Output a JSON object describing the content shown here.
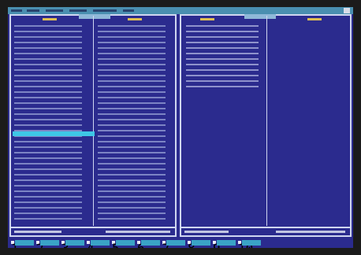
{
  "app": {
    "title": "",
    "accent_color": "#3ec6e6",
    "panel_background": "#2b2b8e",
    "menu_background": "#4a8fb0"
  },
  "menubar": {
    "items": [
      "",
      "",
      "",
      "",
      "",
      ""
    ],
    "close_icon": "close-icon"
  },
  "left_panel": {
    "path": "",
    "columns": [
      "",
      ""
    ],
    "selected_row": 21,
    "status": ""
  },
  "right_panel": {
    "path": "",
    "columns": [
      "",
      ""
    ],
    "status": ""
  },
  "keybar": {
    "keys": [
      {
        "num": "1",
        "label": ""
      },
      {
        "num": "2",
        "label": ""
      },
      {
        "num": "3",
        "label": ""
      },
      {
        "num": "4",
        "label": ""
      },
      {
        "num": "5",
        "label": ""
      },
      {
        "num": "6",
        "label": ""
      },
      {
        "num": "7",
        "label": ""
      },
      {
        "num": "8",
        "label": ""
      },
      {
        "num": "9",
        "label": ""
      },
      {
        "num": "10",
        "label": ""
      }
    ]
  }
}
